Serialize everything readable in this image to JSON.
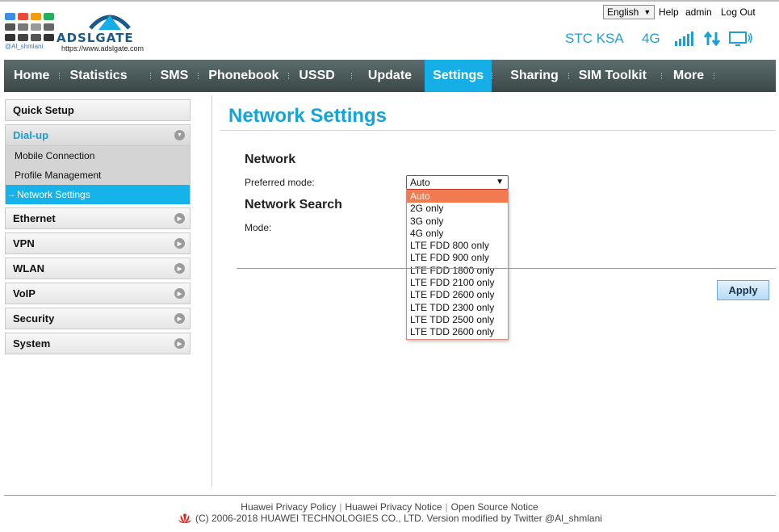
{
  "brand": {
    "logo_text": "ADSLGATE",
    "twitter": "@Al_shmlani",
    "url": "https://www.adslgate.com",
    "colors": {
      "accent": "#16aee6",
      "nav": "#3a4747",
      "selected_option": "#f27a50"
    }
  },
  "topbar": {
    "language": "English",
    "help": "Help",
    "user": "admin",
    "logout": "Log Out"
  },
  "status": {
    "operator": "STC KSA",
    "network_type": "4G",
    "icons": [
      "signal-icon",
      "data-transfer-icon",
      "connected-monitor-icon"
    ]
  },
  "nav": {
    "items": [
      {
        "label": "Home"
      },
      {
        "label": "Statistics"
      },
      {
        "label": "SMS"
      },
      {
        "label": "Phonebook"
      },
      {
        "label": "USSD"
      },
      {
        "label": "Update"
      },
      {
        "label": "Settings",
        "active": true
      },
      {
        "label": "Sharing"
      },
      {
        "label": "SIM Toolkit"
      },
      {
        "label": "More"
      }
    ]
  },
  "sidebar": {
    "quick_setup": "Quick Setup",
    "dialup": {
      "label": "Dial-up",
      "children": [
        "Mobile Connection",
        "Profile Management",
        "Network Settings"
      ]
    },
    "collapsed": [
      "Ethernet",
      "VPN",
      "WLAN",
      "VoIP",
      "Security",
      "System"
    ]
  },
  "main": {
    "title": "Network Settings",
    "network_heading": "Network",
    "preferred_mode_label": "Preferred mode:",
    "preferred_mode_value": "Auto",
    "search_heading": "Network Search",
    "mode_label": "Mode:",
    "options": [
      "Auto",
      "2G only",
      "3G only",
      "4G only",
      "LTE FDD 800 only",
      "LTE FDD 900 only",
      "LTE FDD 1800 only",
      "LTE FDD 2100 only",
      "LTE FDD 2600 only",
      "LTE TDD 2300 only",
      "LTE TDD 2500 only",
      "LTE TDD 2600 only"
    ],
    "apply_label": "Apply"
  },
  "footer": {
    "privacy_policy": "Huawei Privacy Policy",
    "privacy_notice": "Huawei Privacy Notice",
    "open_source": "Open Source Notice",
    "copyright": "(C) 2006-2018 HUAWEI TECHNOLOGIES CO., LTD. Version modified by Twitter @Al_shmlani"
  }
}
